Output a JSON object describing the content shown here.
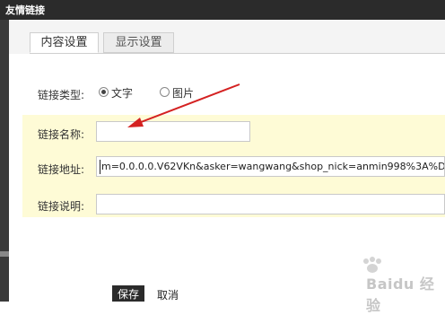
{
  "window": {
    "title": "友情链接"
  },
  "tabs": [
    {
      "label": "内容设置",
      "active": true
    },
    {
      "label": "显示设置",
      "active": false
    }
  ],
  "form": {
    "link_type": {
      "label": "链接类型:",
      "options": [
        {
          "label": "文字",
          "selected": true
        },
        {
          "label": "图片",
          "selected": false
        }
      ]
    },
    "link_name": {
      "label": "链接名称:",
      "value": ""
    },
    "link_url": {
      "label": "链接地址:",
      "value": "m=0.0.0.0.V62VKn&asker=wangwang&shop_nick=anmin998%3A%D("
    },
    "link_desc": {
      "label": "链接说明:",
      "value": ""
    }
  },
  "buttons": {
    "save": "保存",
    "cancel": "取消"
  },
  "annotation": {
    "arrow_color": "#d42121"
  },
  "watermark": {
    "text": "Baidu 经验"
  },
  "colors": {
    "titlebar": "#2b2b2b",
    "panel_highlight": "#fefbd6",
    "save_button": "#2b2b2b"
  }
}
